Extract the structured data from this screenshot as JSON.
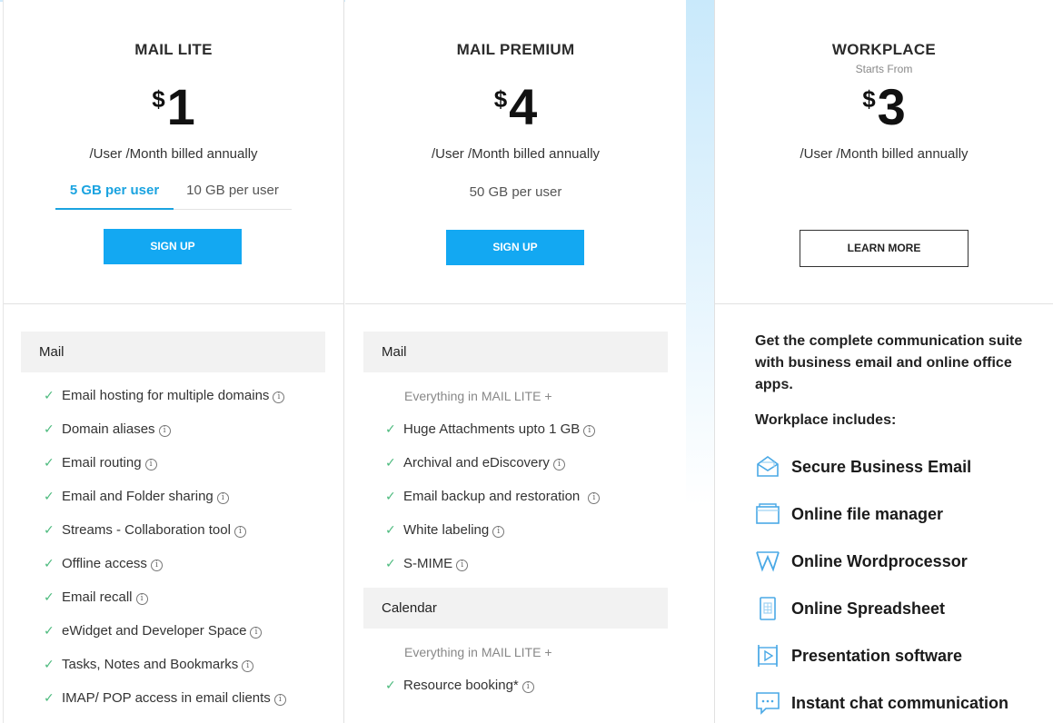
{
  "plans": [
    {
      "name": "MAIL LITE",
      "currency": "$",
      "price": "1",
      "billing": "/User /Month billed annually",
      "tabs": [
        "5 GB per user",
        "10 GB per user"
      ],
      "cta": "SIGN UP",
      "sections": [
        {
          "title": "Mail",
          "features": [
            "Email hosting for multiple domains",
            "Domain aliases",
            "Email routing",
            "Email and Folder sharing",
            "Streams - Collaboration tool",
            "Offline access",
            "Email recall",
            "eWidget and Developer Space",
            "Tasks, Notes and Bookmarks",
            "IMAP/ POP access in email clients"
          ]
        }
      ]
    },
    {
      "name": "MAIL PREMIUM",
      "currency": "$",
      "price": "4",
      "billing": "/User /Month billed annually",
      "storage": "50 GB per user",
      "cta": "SIGN UP",
      "sections": [
        {
          "title": "Mail",
          "note": "Everything in MAIL LITE +",
          "features": [
            "Huge Attachments upto 1 GB",
            "Archival and eDiscovery",
            "Email backup and restoration",
            "White labeling",
            "S-MIME"
          ]
        },
        {
          "title": "Calendar",
          "note": "Everything in MAIL LITE +",
          "features": [
            "Resource booking*"
          ]
        }
      ]
    },
    {
      "name": "WORKPLACE",
      "starts_from": "Starts From",
      "currency": "$",
      "price": "3",
      "billing": "/User /Month billed annually",
      "cta": "LEARN MORE",
      "description": "Get the complete communication suite with business email and online office apps.",
      "includes_title": "Workplace includes:",
      "includes": [
        {
          "label": "Secure Business Email",
          "icon": "envelope-icon"
        },
        {
          "label": "Online file manager",
          "icon": "folder-icon"
        },
        {
          "label": "Online Wordprocessor",
          "icon": "writer-icon"
        },
        {
          "label": "Online Spreadsheet",
          "icon": "spreadsheet-icon"
        },
        {
          "label": "Presentation software",
          "icon": "presentation-icon"
        },
        {
          "label": "Instant chat communication",
          "icon": "chat-icon"
        }
      ]
    }
  ],
  "icons": {
    "check": "✓",
    "info": "i"
  },
  "colors": {
    "accent": "#13a8f2",
    "tab_active": "#1aa3e0",
    "check": "#4cba7d",
    "icon_stroke": "#4aa9e6"
  }
}
